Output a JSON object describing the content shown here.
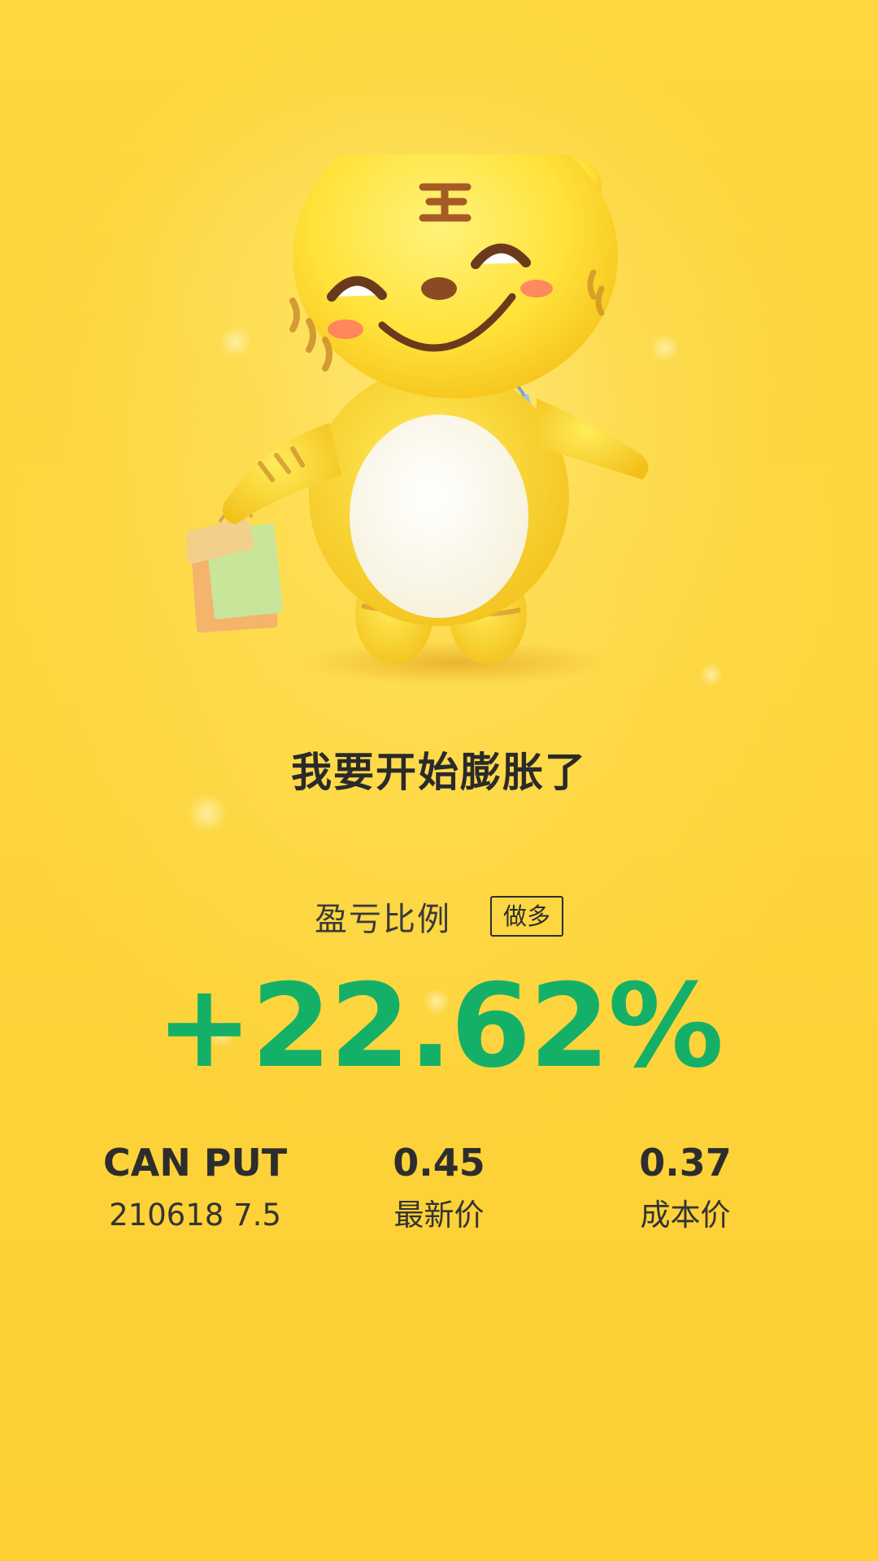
{
  "headline": "我要开始膨胀了",
  "profit_ratio": {
    "label": "盈亏比例",
    "tag": "做多",
    "value": "+22.62%"
  },
  "stats": [
    {
      "value": "CAN PUT",
      "label": "210618 7.5"
    },
    {
      "value": "0.45",
      "label": "最新价"
    },
    {
      "value": "0.37",
      "label": "成本价"
    }
  ],
  "mascot": {
    "icon": "tiger-mascot-with-shopping-bags-icon"
  },
  "colors": {
    "background": "#fdd23a",
    "profit_green": "#15b067",
    "text_dark": "#2d2d2d"
  }
}
